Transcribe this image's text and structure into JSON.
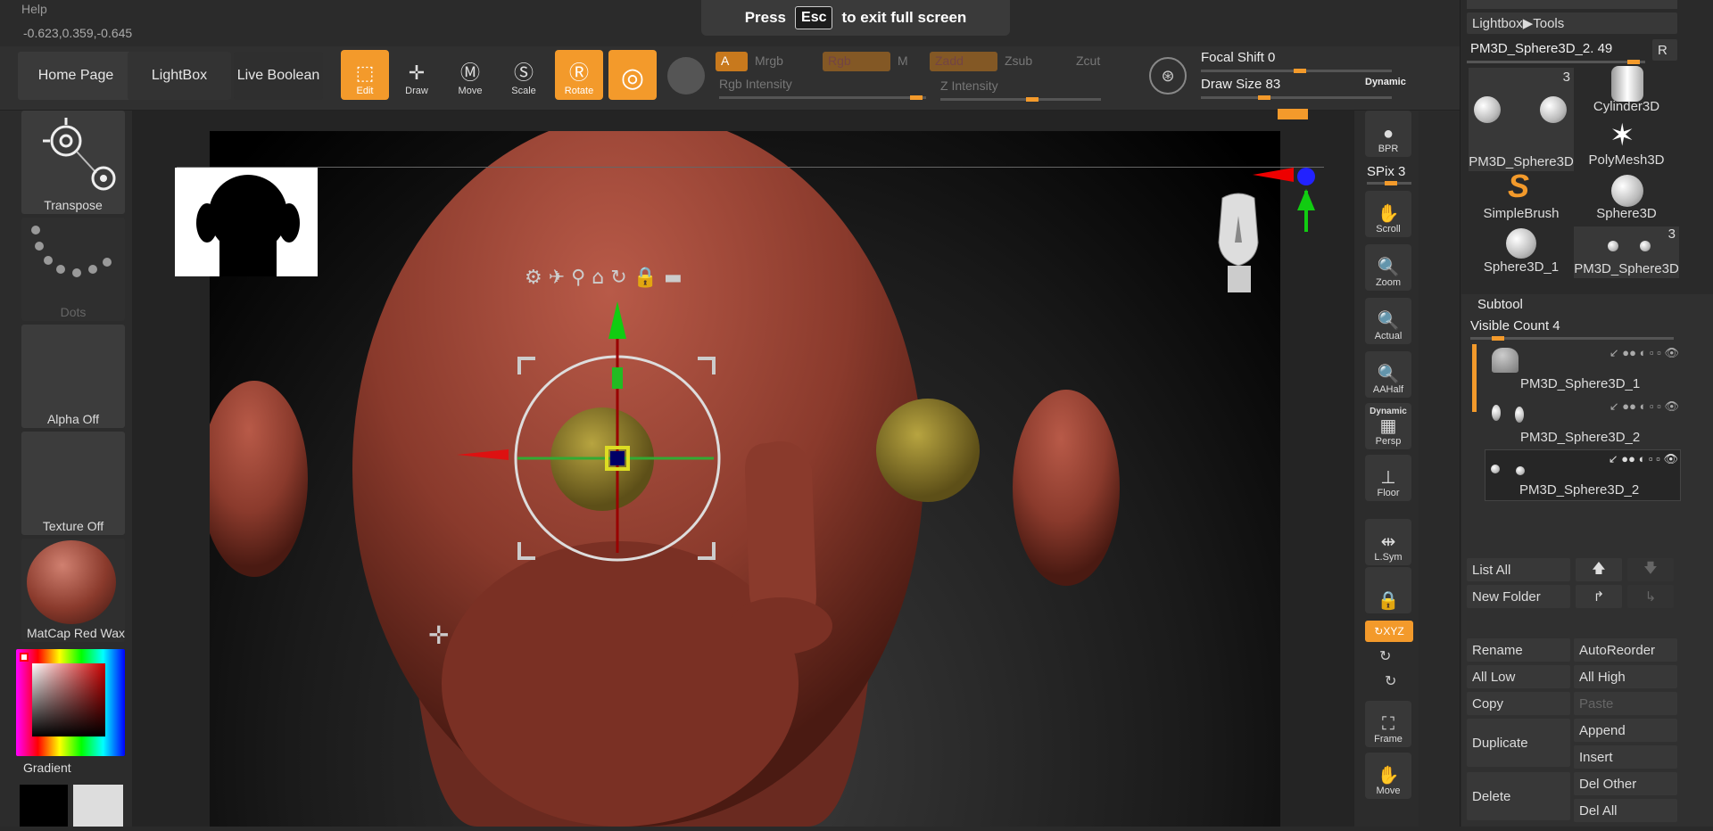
{
  "menu": {
    "help": "Help",
    "coords": "-0.623,0.359,-0.645"
  },
  "banner": {
    "press": "Press",
    "key": "Esc",
    "rest": "to exit full screen"
  },
  "toolbar": {
    "home": "Home Page",
    "lightbox": "LightBox",
    "live_boolean": "Live Boolean",
    "edit": "Edit",
    "draw": "Draw",
    "move": "Move",
    "scale": "Scale",
    "rotate": "Rotate",
    "a_label": "A",
    "mrgb": "Mrgb",
    "rgb": "Rgb",
    "m": "M",
    "zadd": "Zadd",
    "zsub": "Zsub",
    "zcut": "Zcut",
    "rgb_intensity": "Rgb Intensity",
    "z_intensity": "Z Intensity",
    "focal_shift": "Focal Shift 0",
    "draw_size": "Draw Size 83",
    "dynamic": "Dynamic"
  },
  "left": {
    "transpose": "Transpose",
    "dots": "Dots",
    "alpha": "Alpha Off",
    "texture": "Texture Off",
    "material": "MatCap Red Wax",
    "gradient": "Gradient"
  },
  "right_strip": {
    "bpr": "BPR",
    "spix": "SPix 3",
    "scroll": "Scroll",
    "zoom": "Zoom",
    "actual": "Actual",
    "aahalf": "AAHalf",
    "dynamic": "Dynamic",
    "persp": "Persp",
    "floor": "Floor",
    "lsym": "L.Sym",
    "xyz": "XYZ",
    "frame": "Frame",
    "move": "Move"
  },
  "panel": {
    "lightbox_tools": "Lightbox▶Tools",
    "current_tool": "PM3D_Sphere3D_2. 49",
    "r": "R",
    "thumbs": [
      {
        "label": "PM3D_Sphere3D",
        "count": "3"
      },
      {
        "label": "Cylinder3D"
      },
      {
        "label": "PolyMesh3D"
      },
      {
        "label": "SimpleBrush"
      },
      {
        "label": "Sphere3D"
      },
      {
        "label": "Sphere3D_1"
      },
      {
        "label": "PM3D_Sphere3D",
        "count": "3"
      }
    ],
    "subtool": "Subtool",
    "visible_count": "Visible Count 4",
    "subtools": [
      "PM3D_Sphere3D_1",
      "PM3D_Sphere3D_2",
      "PM3D_Sphere3D_2"
    ],
    "list_all": "List All",
    "new_folder": "New Folder",
    "rename": "Rename",
    "autoreorder": "AutoReorder",
    "all_low": "All Low",
    "all_high": "All High",
    "copy": "Copy",
    "paste": "Paste",
    "duplicate": "Duplicate",
    "append": "Append",
    "insert": "Insert",
    "delete": "Delete",
    "del_other": "Del Other",
    "del_all": "Del All"
  },
  "colors": {
    "accent": "#f39a2b",
    "wax": "#8a3a2c",
    "eye": "#8a7a2a"
  }
}
